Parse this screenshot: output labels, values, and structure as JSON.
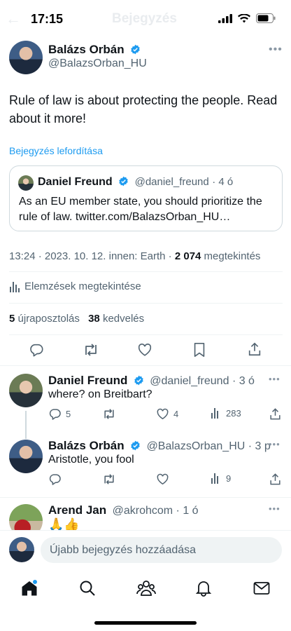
{
  "status_bar": {
    "time": "17:15",
    "ghost_title": "Bejegyzés"
  },
  "main_post": {
    "author_name": "Balázs Orbán",
    "author_handle": "@BalazsOrban_HU",
    "text": "Rule of law is about protecting the people. Read about it more!",
    "translate_label": "Bejegyzés lefordítása",
    "quote": {
      "author_name": "Daniel Freund",
      "author_handle": "@daniel_freund",
      "age": "· 4 ó",
      "text": "As an EU member state, you should prioritize the rule of law. twitter.com/BalazsOrban_HU…"
    },
    "meta_time": "13:24 · 2023. 10. 12. innen: Earth · ",
    "views_count": "2 074",
    "views_label": " megtekintés",
    "analytics_label": "Elemzések megtekintése",
    "reposts_count": "5",
    "reposts_label": "újraposztolás",
    "likes_count": "38",
    "likes_label": "kedvelés"
  },
  "replies": [
    {
      "author_name": "Daniel Freund",
      "author_handle": "@daniel_freund",
      "age": "· 3 ó",
      "text": "where? on Breitbart?",
      "replies": "5",
      "retweets": "",
      "likes": "4",
      "views": "283"
    },
    {
      "author_name": "Balázs Orbán",
      "author_handle": "@BalazsOrban_HU",
      "age": "· 3 p",
      "text": "Aristotle, you fool",
      "replies": "",
      "retweets": "",
      "likes": "",
      "views": "9"
    },
    {
      "author_name": "Arend Jan",
      "author_handle": "@akrohcom",
      "age": "· 1 ó",
      "text": "🙏👍"
    }
  ],
  "composer": {
    "placeholder": "Újabb bejegyzés hozzáadása"
  },
  "nav": [
    "home-icon",
    "search-icon",
    "communities-icon",
    "notifications-icon",
    "messages-icon"
  ],
  "colors": {
    "accent": "#1d9bf0",
    "text": "#0f1419",
    "muted": "#536471",
    "divider": "#eff3f4"
  }
}
